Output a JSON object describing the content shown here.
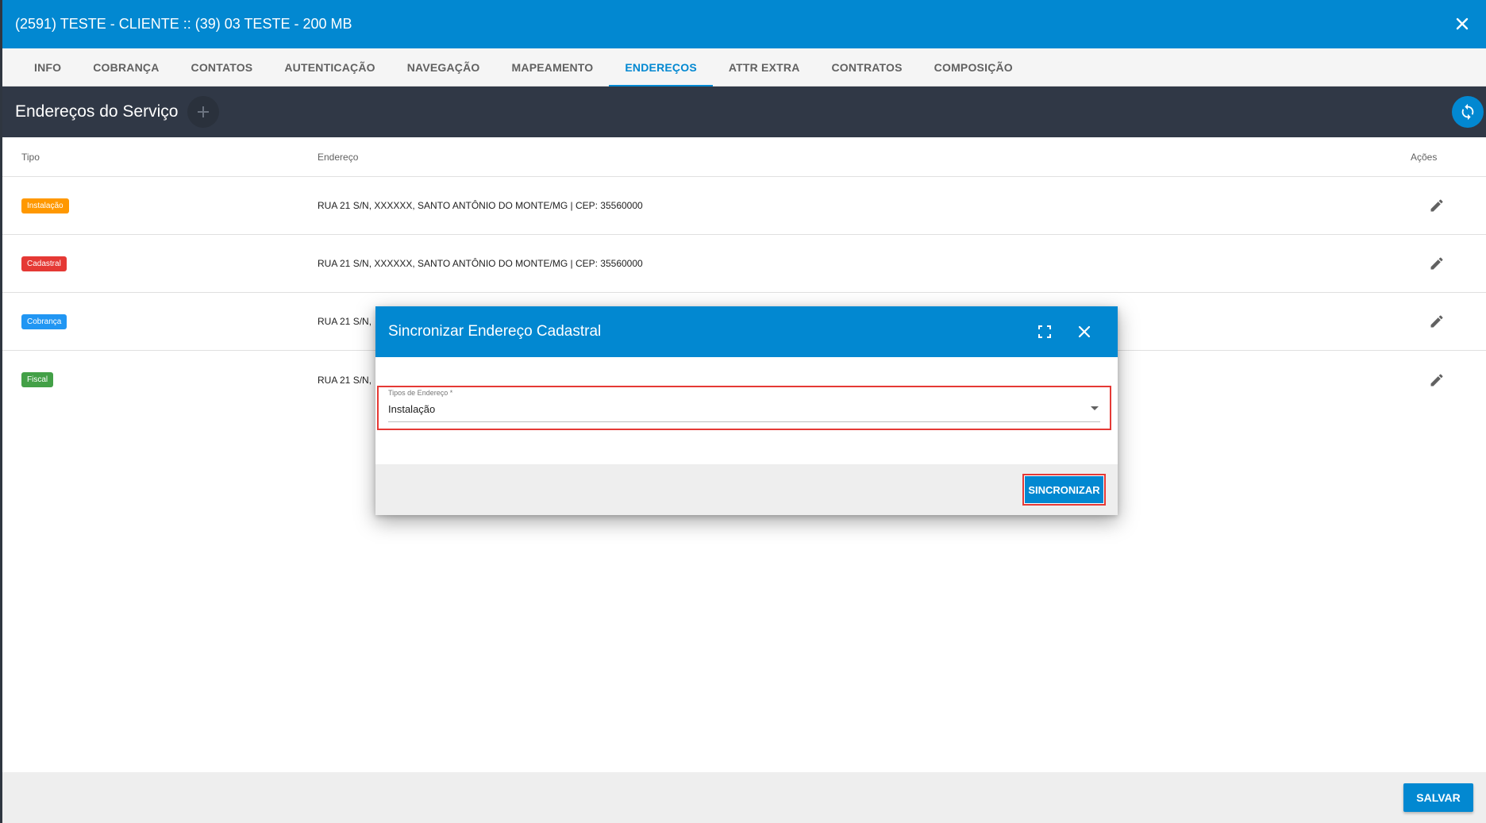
{
  "window": {
    "title": "(2591) TESTE - CLIENTE :: (39) 03 TESTE - 200 MB",
    "close_icon": "close-icon"
  },
  "tabs": [
    {
      "label": "INFO",
      "active": false
    },
    {
      "label": "COBRANÇA",
      "active": false
    },
    {
      "label": "CONTATOS",
      "active": false
    },
    {
      "label": "AUTENTICAÇÃO",
      "active": false
    },
    {
      "label": "NAVEGAÇÃO",
      "active": false
    },
    {
      "label": "MAPEAMENTO",
      "active": false
    },
    {
      "label": "ENDEREÇOS",
      "active": true
    },
    {
      "label": "ATTR EXTRA",
      "active": false
    },
    {
      "label": "CONTRATOS",
      "active": false
    },
    {
      "label": "COMPOSIÇÃO",
      "active": false
    }
  ],
  "section": {
    "title": "Endereços do Serviço",
    "add_icon": "plus-icon",
    "sync_icon": "sync-icon"
  },
  "table": {
    "headers": {
      "tipo": "Tipo",
      "endereco": "Endereço",
      "acoes": "Ações"
    },
    "rows": [
      {
        "tipo": "Instalação",
        "color": "#ff9800",
        "endereco": "RUA 21 S/N, XXXXXX, SANTO ANTÔNIO DO MONTE/MG | CEP: 35560000"
      },
      {
        "tipo": "Cadastral",
        "color": "#e53935",
        "endereco": "RUA 21 S/N, XXXXXX, SANTO ANTÔNIO DO MONTE/MG | CEP: 35560000"
      },
      {
        "tipo": "Cobrança",
        "color": "#2196f3",
        "endereco": "RUA 21 S/N,"
      },
      {
        "tipo": "Fiscal",
        "color": "#43a047",
        "endereco": "RUA 21 S/N,"
      }
    ]
  },
  "dialog": {
    "title": "Sincronizar Endereço Cadastral",
    "field_label": "Tipos de Endereço *",
    "field_value": "Instalação",
    "sync_label": "SINCRONIZAR"
  },
  "footer": {
    "save_label": "SALVAR"
  },
  "colors": {
    "primary": "#0288d1",
    "dark_bar": "#303846",
    "highlight": "#e53935"
  }
}
